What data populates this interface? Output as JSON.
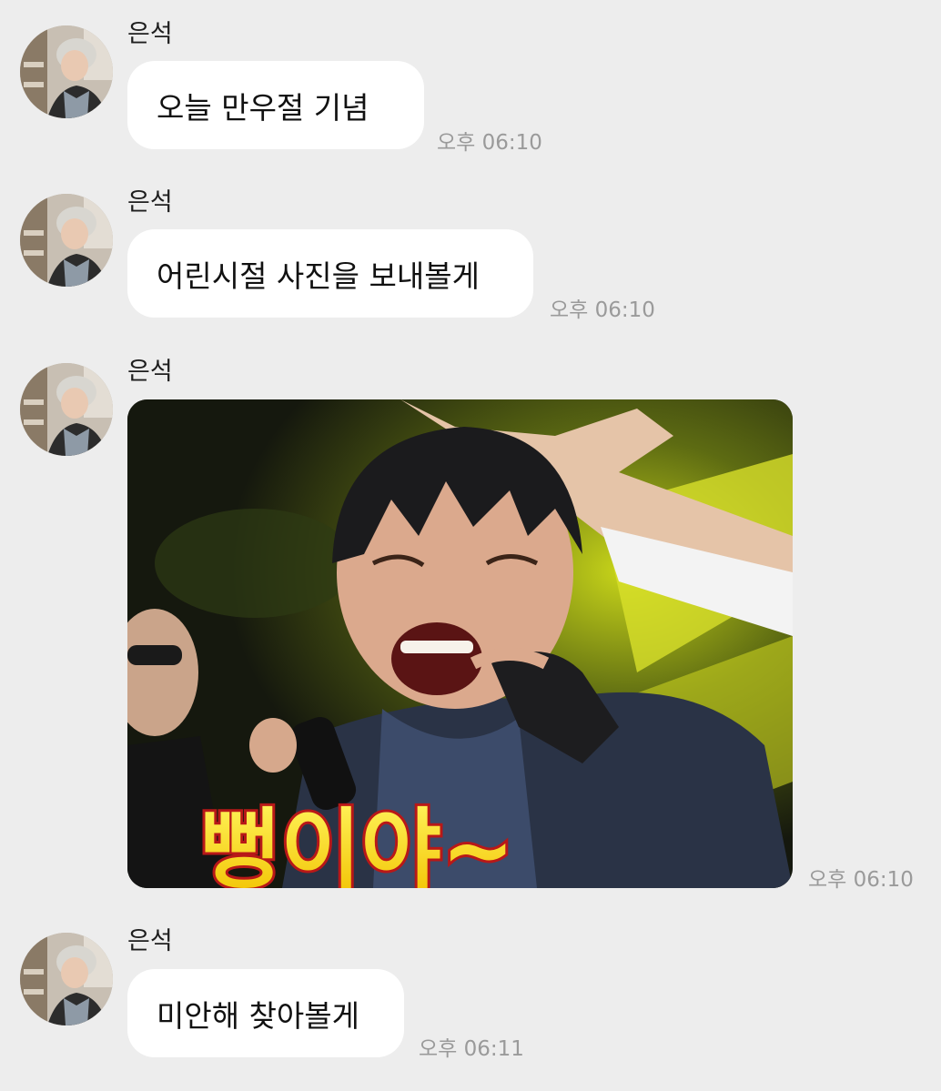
{
  "sender_name": "은석",
  "messages": [
    {
      "type": "text",
      "text": "오늘 만우절 기념",
      "time": "오후 06:10"
    },
    {
      "type": "text",
      "text": "어린시절 사진을 보내볼게",
      "time": "오후 06:10"
    },
    {
      "type": "image",
      "caption": "뻥이야~",
      "time": "오후 06:10"
    },
    {
      "type": "text",
      "text": "미안해 찾아볼게",
      "time": "오후 06:11"
    }
  ]
}
